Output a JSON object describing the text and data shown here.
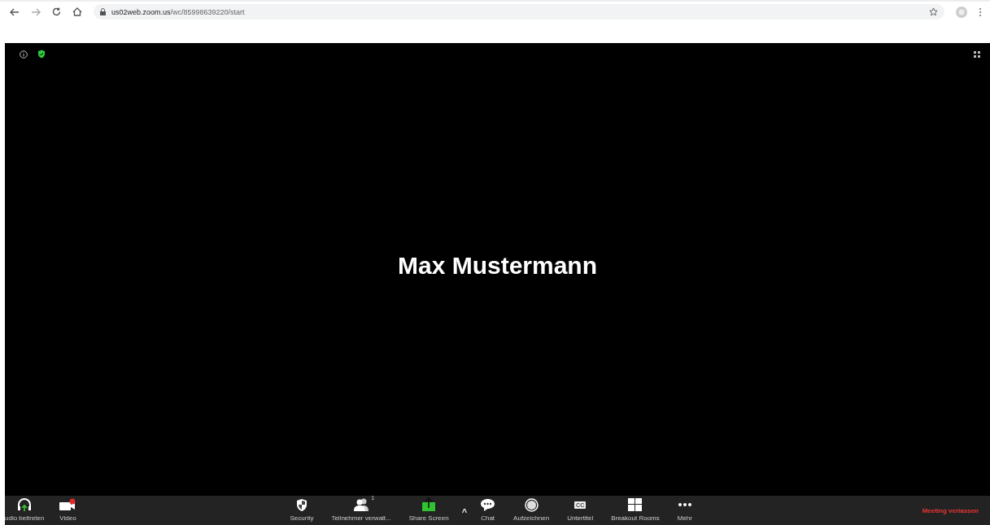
{
  "browser": {
    "url_host": "us02web.zoom.us",
    "url_path": "/wc/85998639220/start"
  },
  "meeting": {
    "participant_name": "Max Mustermann"
  },
  "toolbar": {
    "left": [
      {
        "kind": "audio",
        "label": "udio beitreten"
      },
      {
        "kind": "video",
        "label": "Video"
      }
    ],
    "center": [
      {
        "kind": "security",
        "label": "Security"
      },
      {
        "kind": "participants",
        "label": "Teilnehmer verwalt...",
        "badge": "1"
      },
      {
        "kind": "share",
        "label": "Share Screen"
      },
      {
        "kind": "caret",
        "label": "^"
      },
      {
        "kind": "chat",
        "label": "Chat"
      },
      {
        "kind": "record",
        "label": "Aufzeichnen"
      },
      {
        "kind": "cc",
        "label": "Untertitel",
        "icon_text": "CC"
      },
      {
        "kind": "breakout",
        "label": "Breakout Rooms"
      },
      {
        "kind": "more",
        "label": "Mehr"
      }
    ],
    "leave_label": "Meeting verlassen"
  }
}
